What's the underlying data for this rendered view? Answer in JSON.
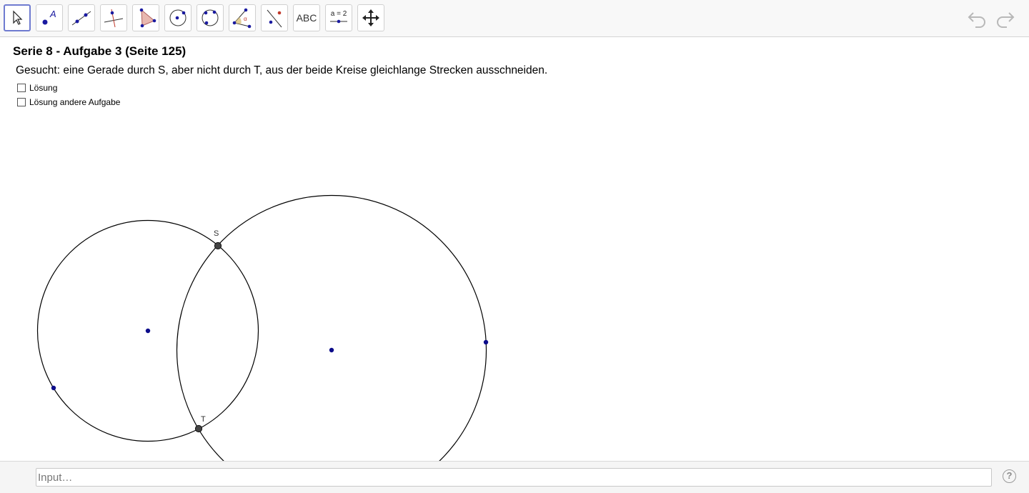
{
  "toolbar": {
    "tools": [
      {
        "id": "move",
        "icon": "arrow-cursor-icon"
      },
      {
        "id": "point",
        "icon": "point-icon",
        "glyph": "A"
      },
      {
        "id": "line",
        "icon": "line-through-points-icon"
      },
      {
        "id": "perpendicular",
        "icon": "perpendicular-line-icon"
      },
      {
        "id": "polygon",
        "icon": "polygon-icon"
      },
      {
        "id": "circle",
        "icon": "circle-center-point-icon"
      },
      {
        "id": "circle3",
        "icon": "circle-three-points-icon"
      },
      {
        "id": "angle",
        "icon": "angle-icon",
        "glyph": "α"
      },
      {
        "id": "reflect",
        "icon": "reflect-about-line-icon"
      },
      {
        "id": "text",
        "icon": "text-icon",
        "label": "ABC"
      },
      {
        "id": "slider",
        "icon": "slider-icon",
        "label": "a = 2"
      },
      {
        "id": "move-view",
        "icon": "move-graphics-view-icon"
      }
    ],
    "active_tool": "move",
    "undo_icon": "undo-icon",
    "redo_icon": "redo-icon"
  },
  "title": "Serie 8 - Aufgabe 3 (Seite 125)",
  "task": "Gesucht: eine Gerade durch S, aber nicht durch T, aus der beide Kreise gleichlange Strecken ausschneiden.",
  "checkboxes": [
    {
      "label": "Lösung",
      "checked": false
    },
    {
      "label": "Lösung andere Aufgabe",
      "checked": false
    }
  ],
  "geometry": {
    "points": [
      {
        "label": "S",
        "style": "intersection"
      },
      {
        "label": "T",
        "style": "intersection"
      }
    ],
    "colors": {
      "free_point": "#0c0c8a",
      "intersection_point": "#444444",
      "circle": "#000000",
      "active_border": "#6f7bd0"
    }
  },
  "input": {
    "placeholder": "Input…",
    "value": ""
  },
  "help": {
    "icon": "help-icon",
    "glyph": "?"
  }
}
